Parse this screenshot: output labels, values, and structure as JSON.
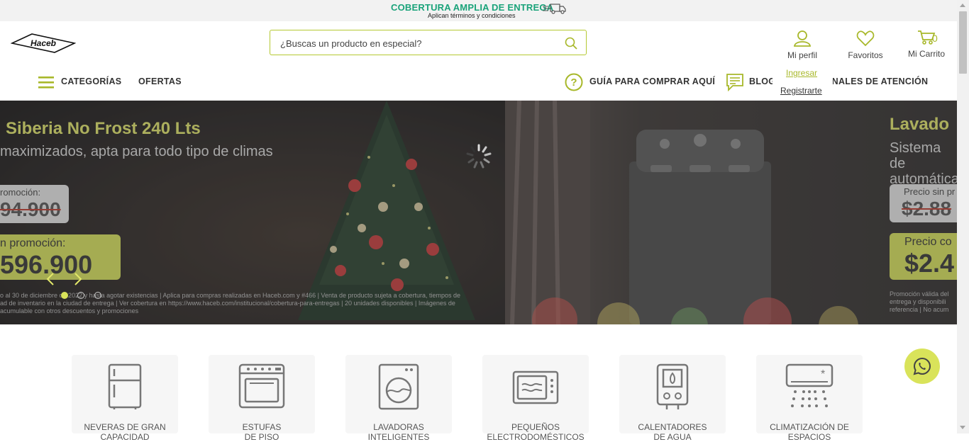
{
  "topbar": {
    "headline": "COBERTURA AMPLIA DE ENTREGA",
    "subline": "Aplican términos y condiciones"
  },
  "header": {
    "logo_text": "Haceb",
    "search_placeholder": "¿Buscas un producto en especial?",
    "profile_label": "Mi perfil",
    "favorites_label": "Favoritos",
    "cart_label": "Mi Carrito",
    "cart_count": "0"
  },
  "profile_menu": {
    "login": "Ingresar",
    "register": "Registrarte"
  },
  "nav": {
    "categories": "CATEGORÍAS",
    "offers": "OFERTAS",
    "guide": "GUÍA PARA COMPRAR AQUÍ",
    "blog": "BLOG",
    "channels": "CANALES DE ATENCIÓN"
  },
  "hero": {
    "slide1": {
      "title": "Siberia No Frost 240 Lts",
      "subtitle": "maximizados, apta para todo tipo de climas",
      "price_label_before": "romoción:",
      "price_before": "94.900",
      "price_label_now": "n promoción:",
      "price_now": "596.900",
      "fine_line1": "o al 30 de diciembre de 2022 y hasta agotar existencias | Aplica para compras realizadas en Haceb.com y #466 | Venta de producto sujeta a cobertura, tiempos de",
      "fine_line2": "ad de inventario en la ciudad de entrega | Ver cobertura en https://www.haceb.com/institucional/cobertura-para-entregas | 20 unidades disponibles | Imágenes de",
      "fine_line3": "acumulable con otros descuentos y promociones"
    },
    "slide2": {
      "title": "Lavado",
      "subtitle1": "Sistema de",
      "subtitle2": "automática",
      "price_label_before": "Precio sin pr",
      "price_before": "$2.88",
      "price_label_now": "Precio co",
      "price_now": "$2.4",
      "fine_line1": "Promoción válida del",
      "fine_line2": "entrega y disponibili",
      "fine_line3": "referencia | No acum"
    }
  },
  "categories": [
    {
      "line1": "NEVERAS DE GRAN",
      "line2": "CAPACIDAD"
    },
    {
      "line1": "ESTUFAS",
      "line2": "DE PISO"
    },
    {
      "line1": "LAVADORAS",
      "line2": "INTELIGENTES"
    },
    {
      "line1": "PEQUEÑOS",
      "line2": "ELECTRODOMÉSTICOS"
    },
    {
      "line1": "CALENTADORES",
      "line2": "DE AGUA"
    },
    {
      "line1": "CLIMATIZACIÓN DE",
      "line2": "ESPACIOS"
    }
  ],
  "colors": {
    "accent": "#b5c832",
    "coverage_green": "#1aa37a",
    "promo_yellow": "#d9e35a"
  }
}
